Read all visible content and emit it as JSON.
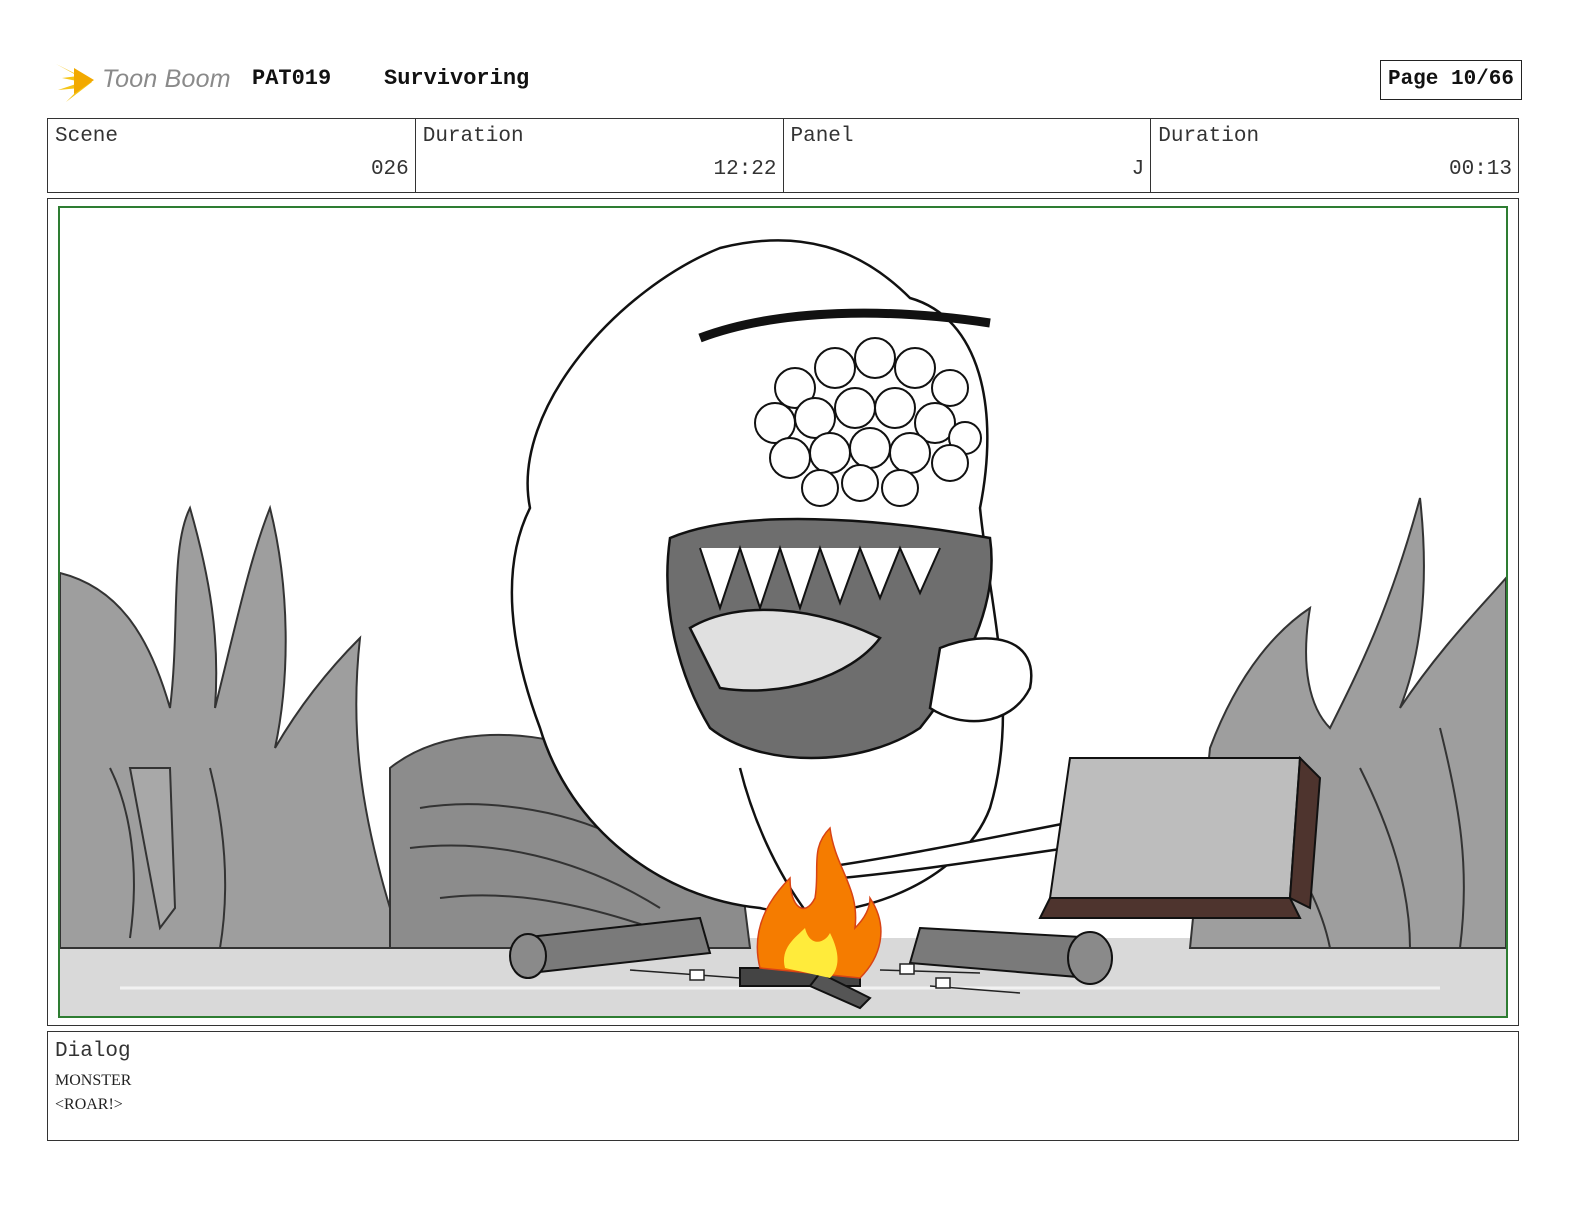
{
  "header": {
    "logo_text": "Toon Boom",
    "project_code": "PAT019",
    "episode_title": "Survivoring",
    "page_label": "Page 10/66"
  },
  "info": {
    "scene_label": "Scene",
    "scene_value": "026",
    "scene_duration_label": "Duration",
    "scene_duration_value": "12:22",
    "panel_label": "Panel",
    "panel_value": "J",
    "panel_duration_label": "Duration",
    "panel_duration_value": "00:13"
  },
  "dialog": {
    "label": "Dialog",
    "lines": [
      "MONSTER",
      "<ROAR!>"
    ]
  },
  "colors": {
    "panel_border": "#2e7d32",
    "flame_outer": "#f57c00",
    "flame_inner": "#ffeb3b",
    "logo_star": "#f5c518"
  }
}
